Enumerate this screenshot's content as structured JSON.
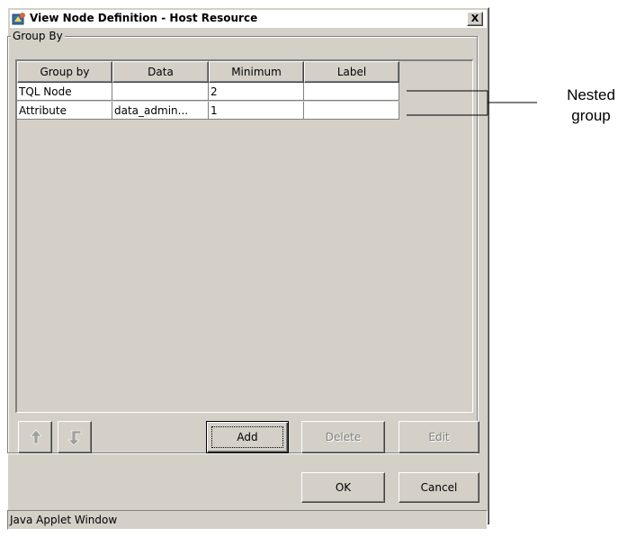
{
  "window": {
    "title": "View Node Definition - Host Resource",
    "close_label": "X"
  },
  "group": {
    "legend": "Group By"
  },
  "table": {
    "headers": [
      "Group by",
      "Data",
      "Minimum",
      "Label"
    ],
    "rows": [
      [
        "TQL Node",
        "",
        "2",
        ""
      ],
      [
        "Attribute",
        "data_admin...",
        "1",
        ""
      ]
    ]
  },
  "buttons": {
    "move_up_icon": "arrow-up-icon",
    "move_down_icon": "arrow-down-turn-icon",
    "add": "Add",
    "delete": "Delete",
    "edit": "Edit",
    "ok": "OK",
    "cancel": "Cancel"
  },
  "status_bar": "Java Applet Window",
  "annotation": {
    "line1": "Nested",
    "line2": "group"
  }
}
